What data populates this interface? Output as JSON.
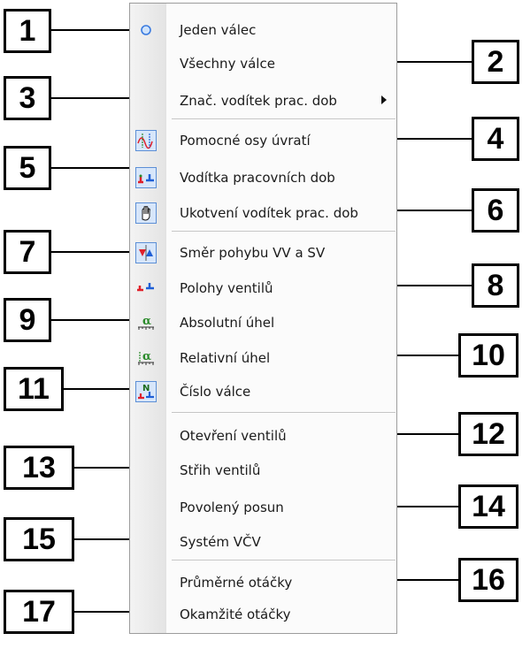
{
  "menu": {
    "items": [
      {
        "label": "Jeden válec",
        "icon": "radio-dot-icon"
      },
      {
        "label": "Všechny válce",
        "icon": ""
      },
      {
        "label": "Znač. vodítek prac. dob",
        "icon": "",
        "submenu": true
      },
      {
        "label": "Pomocné osy úvratí",
        "icon": "auxiliary-axes-icon"
      },
      {
        "label": "Vodítka pracovních dob",
        "icon": "valve-guides-icon"
      },
      {
        "label": "Ukotvení vodítek prac. dob",
        "icon": "hand-anchor-icon"
      },
      {
        "label": "Směr pohybu VV a SV",
        "icon": "motion-direction-icon"
      },
      {
        "label": "Polohy ventilů",
        "icon": "valve-positions-icon"
      },
      {
        "label": "Absolutní úhel",
        "icon": "absolute-angle-icon"
      },
      {
        "label": "Relativní úhel",
        "icon": "relative-angle-icon"
      },
      {
        "label": "Číslo válce",
        "icon": "cylinder-number-icon"
      },
      {
        "label": "Otevření ventilů",
        "icon": ""
      },
      {
        "label": "Střih ventilů",
        "icon": ""
      },
      {
        "label": "Povolený posun",
        "icon": ""
      },
      {
        "label": "Systém VČV",
        "icon": ""
      },
      {
        "label": "Průměrné otáčky",
        "icon": ""
      },
      {
        "label": "Okamžité otáčky",
        "icon": ""
      }
    ],
    "icon_glyphs": {
      "angle_symbol": "α",
      "cylinder_letter": "N"
    }
  },
  "callouts": [
    "1",
    "2",
    "3",
    "4",
    "5",
    "6",
    "7",
    "8",
    "9",
    "10",
    "11",
    "12",
    "13",
    "14",
    "15",
    "16",
    "17"
  ],
  "colors": {
    "callout_border": "#000000",
    "icon_highlight": "#d7e6fa",
    "icon_blue": "#1f5fd6",
    "icon_red": "#e0202a",
    "icon_green": "#2a8a2a"
  }
}
